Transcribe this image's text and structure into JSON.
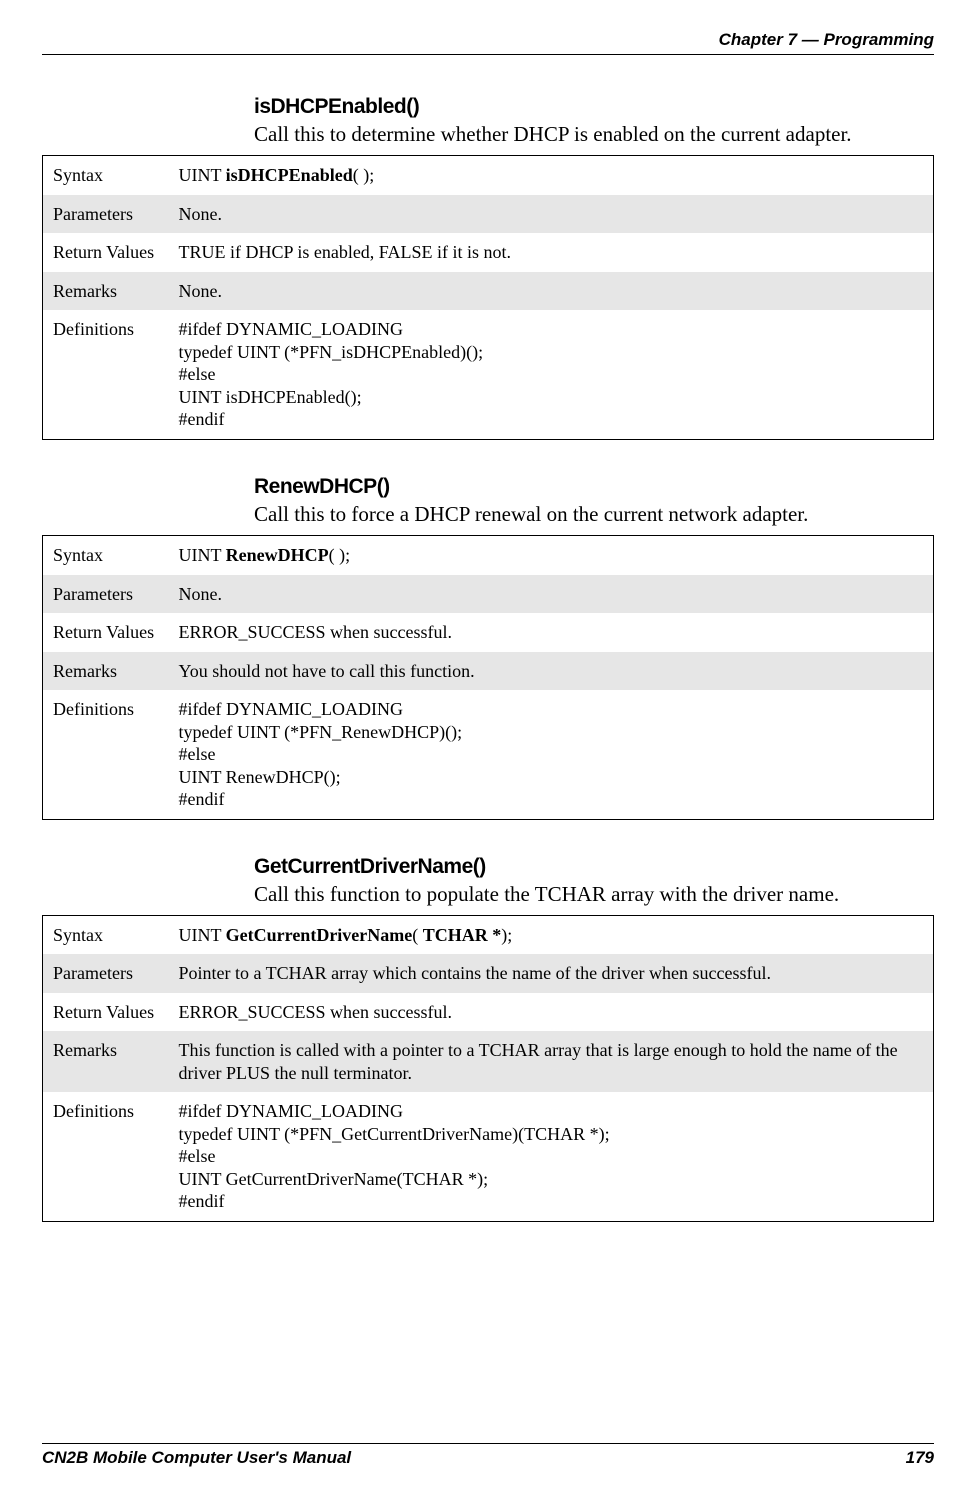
{
  "header": {
    "chapter": "Chapter 7 —  Programming"
  },
  "sections": [
    {
      "heading": "isDHCPEnabled()",
      "description": "Call this to determine whether DHCP is enabled on the current adapter.",
      "rows": {
        "syntax_prefix": "UINT ",
        "syntax_bold": "isDHCPEnabled",
        "syntax_suffix": "( );",
        "parameters": "None.",
        "return_values": "TRUE if DHCP is enabled, FALSE if it is not.",
        "remarks": "None.",
        "definitions": "#ifdef DYNAMIC_LOADING\ntypedef UINT (*PFN_isDHCPEnabled)();\n#else\nUINT isDHCPEnabled();\n#endif"
      }
    },
    {
      "heading": "RenewDHCP()",
      "description": "Call this to force a DHCP renewal on the current network adapter.",
      "rows": {
        "syntax_prefix": "UINT ",
        "syntax_bold": "RenewDHCP",
        "syntax_suffix": "( );",
        "parameters": "None.",
        "return_values": "ERROR_SUCCESS when successful.",
        "remarks": "You should not have to call this function.",
        "definitions": "#ifdef DYNAMIC_LOADING\ntypedef UINT (*PFN_RenewDHCP)();\n#else\nUINT RenewDHCP();\n#endif"
      }
    },
    {
      "heading": "GetCurrentDriverName()",
      "description": "Call this function to populate the TCHAR array with the driver name.",
      "rows": {
        "syntax_prefix": "UINT ",
        "syntax_bold": "GetCurrentDriverName",
        "syntax_middle": "( ",
        "syntax_bold2": "TCHAR *",
        "syntax_suffix": ");",
        "parameters": "Pointer to a TCHAR array which contains the name of the driver when successful.",
        "return_values": "ERROR_SUCCESS when successful.",
        "remarks": "This function is called with a pointer to a TCHAR array that is large enough to hold the name of the driver PLUS the null terminator.",
        "definitions": "#ifdef DYNAMIC_LOADING\ntypedef UINT (*PFN_GetCurrentDriverName)(TCHAR *);\n#else\nUINT GetCurrentDriverName(TCHAR *);\n#endif"
      }
    }
  ],
  "labels": {
    "syntax": "Syntax",
    "parameters": "Parameters",
    "return_values": "Return Values",
    "remarks": "Remarks",
    "definitions": "Definitions"
  },
  "footer": {
    "title": "CN2B Mobile Computer User's Manual",
    "page_number": "179"
  }
}
